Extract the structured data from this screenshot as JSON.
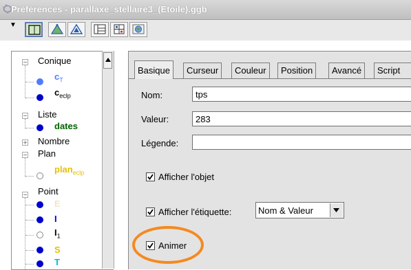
{
  "window": {
    "title": "Préférences - parallaxe_stellaire3_(Etoile).ggb",
    "menu_arrow": "▼"
  },
  "toolbar": {
    "buttons": [
      {
        "icon": "select-object-icon",
        "selected": true
      },
      {
        "icon": "triangle-icon",
        "selected": false
      },
      {
        "icon": "triangle-outline-icon",
        "selected": false
      },
      {
        "icon": "layout-icon",
        "selected": false
      },
      {
        "icon": "grid-icon",
        "selected": false
      },
      {
        "icon": "globe-icon",
        "selected": false
      }
    ]
  },
  "tree": {
    "groups": [
      {
        "label": "Conique",
        "expanded": true,
        "items": [
          {
            "name": "c",
            "sub": "T",
            "color": "#4f7bff"
          },
          {
            "name": "c",
            "sub": "eclp",
            "color": "#0000cc"
          }
        ]
      },
      {
        "label": "Liste",
        "expanded": true,
        "items": [
          {
            "name": "dates",
            "sub": "",
            "color": "#006400"
          }
        ]
      },
      {
        "label": "Nombre",
        "expanded": false,
        "items": []
      },
      {
        "label": "Plan",
        "expanded": true,
        "items": [
          {
            "name": "plan",
            "sub": "eclp",
            "color": "#e6c000",
            "hollow": true
          }
        ]
      },
      {
        "label": "Point",
        "expanded": true,
        "items": [
          {
            "name": "E",
            "sub": "",
            "color": "#f3e4c8"
          },
          {
            "name": "I",
            "sub": "",
            "color": "#0000cc"
          },
          {
            "name": "I",
            "sub": "1",
            "color": "#000000",
            "hollow": true
          },
          {
            "name": "S",
            "sub": "",
            "color": "#e6c000"
          },
          {
            "name": "T",
            "sub": "",
            "color": "#00bcd4"
          }
        ]
      }
    ]
  },
  "tabs": [
    {
      "label": "Basique",
      "active": true
    },
    {
      "label": "Curseur",
      "active": false
    },
    {
      "label": "Couleur",
      "active": false
    },
    {
      "label": "Position",
      "active": false
    },
    {
      "label": "Avancé",
      "active": false
    },
    {
      "label": "Script",
      "active": false
    }
  ],
  "basic": {
    "name_label": "Nom:",
    "name_value": "tps",
    "value_label": "Valeur:",
    "value_value": "283",
    "caption_label": "Légende:",
    "caption_value": "",
    "show_object_label": "Afficher l'objet",
    "show_object_checked": true,
    "show_label_label": "Afficher l'étiquette:",
    "show_label_checked": true,
    "label_mode": "Nom & Valeur",
    "animate_label": "Animer",
    "animate_checked": true
  },
  "colors": {
    "highlight": "#f5891f",
    "selected_tool": "#5b7bb3"
  }
}
